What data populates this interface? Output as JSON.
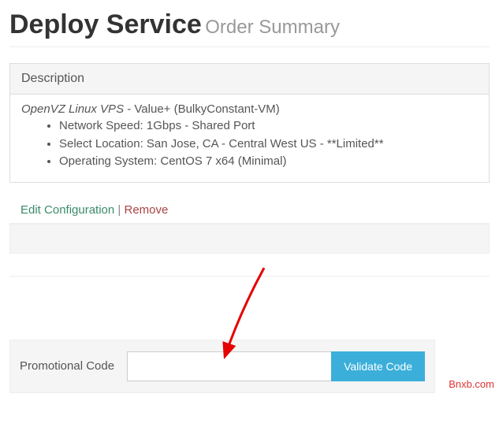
{
  "header": {
    "title": "Deploy Service",
    "subtitle": "Order Summary"
  },
  "description": {
    "panel_title": "Description",
    "product_name": "OpenVZ Linux VPS",
    "product_variant": " - Value+ (BulkyConstant-VM)",
    "specs": [
      "Network Speed: 1Gbps - Shared Port",
      "Select Location: San Jose, CA - Central West US - **Limited**",
      "Operating System: CentOS 7 x64 (Minimal)"
    ]
  },
  "actions": {
    "edit": "Edit Configuration",
    "separator": " | ",
    "remove": "Remove"
  },
  "promo": {
    "label": "Promotional Code",
    "placeholder": "",
    "button": "Validate Code"
  },
  "watermark": "Bnxb.com"
}
